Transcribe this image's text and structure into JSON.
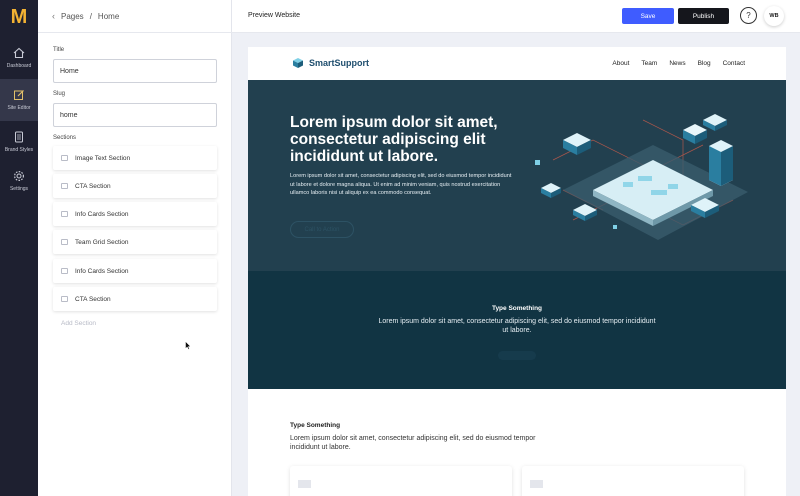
{
  "rail": {
    "logo": "M",
    "items": [
      {
        "label": "Dashboard",
        "icon": "home-icon"
      },
      {
        "label": "Site Editor",
        "icon": "edit-icon"
      },
      {
        "label": "Brand Styles",
        "icon": "brand-styles-icon"
      },
      {
        "label": "Settings",
        "icon": "gear-icon"
      }
    ]
  },
  "panel": {
    "breadcrumb": {
      "parent": "Pages",
      "separator": "/",
      "current": "Home"
    },
    "title_label": "Title",
    "title_value": "Home",
    "slug_label": "Slug",
    "slug_value": "home",
    "sections_label": "Sections",
    "sections": [
      "Image Text Section",
      "CTA Section",
      "Info Cards Section",
      "Team Grid Section",
      "Info Cards Section",
      "CTA Section"
    ],
    "add_section": "Add Section"
  },
  "topbar": {
    "title": "Preview Website",
    "save": "Save",
    "publish": "Publish",
    "help": "?",
    "avatar": "WB"
  },
  "preview": {
    "brand": "SmartSupport",
    "nav": [
      "About",
      "Team",
      "News",
      "Blog",
      "Contact"
    ],
    "hero": {
      "heading": "Lorem ipsum dolor sit amet, consectetur adipiscing elit incididunt ut labore.",
      "body": "Lorem ipsum dolor sit amet, consectetur adipiscing elit, sed do eiusmod tempor incididunt ut labore et dolore magna aliqua. Ut enim ad minim veniam, quis nostrud exercitation ullamco laboris nisi ut aliquip ex ea commodo consequat.",
      "cta": "Call to Action"
    },
    "band": {
      "heading": "Type Something",
      "body": "Lorem ipsum dolor sit amet, consectetur adipiscing elit, sed do eiusmod tempor incididunt ut labore."
    },
    "section3": {
      "heading": "Type Something",
      "body": "Lorem ipsum dolor sit amet, consectetur adipiscing elit, sed do eiusmod tempor incididunt ut labore."
    }
  },
  "colors": {
    "rail_bg": "#1e2030",
    "logo": "#f2b233",
    "save_btn": "#3f5cff",
    "publish_btn": "#15161c",
    "hero_bg": "#22404f",
    "band_bg": "#113443"
  }
}
